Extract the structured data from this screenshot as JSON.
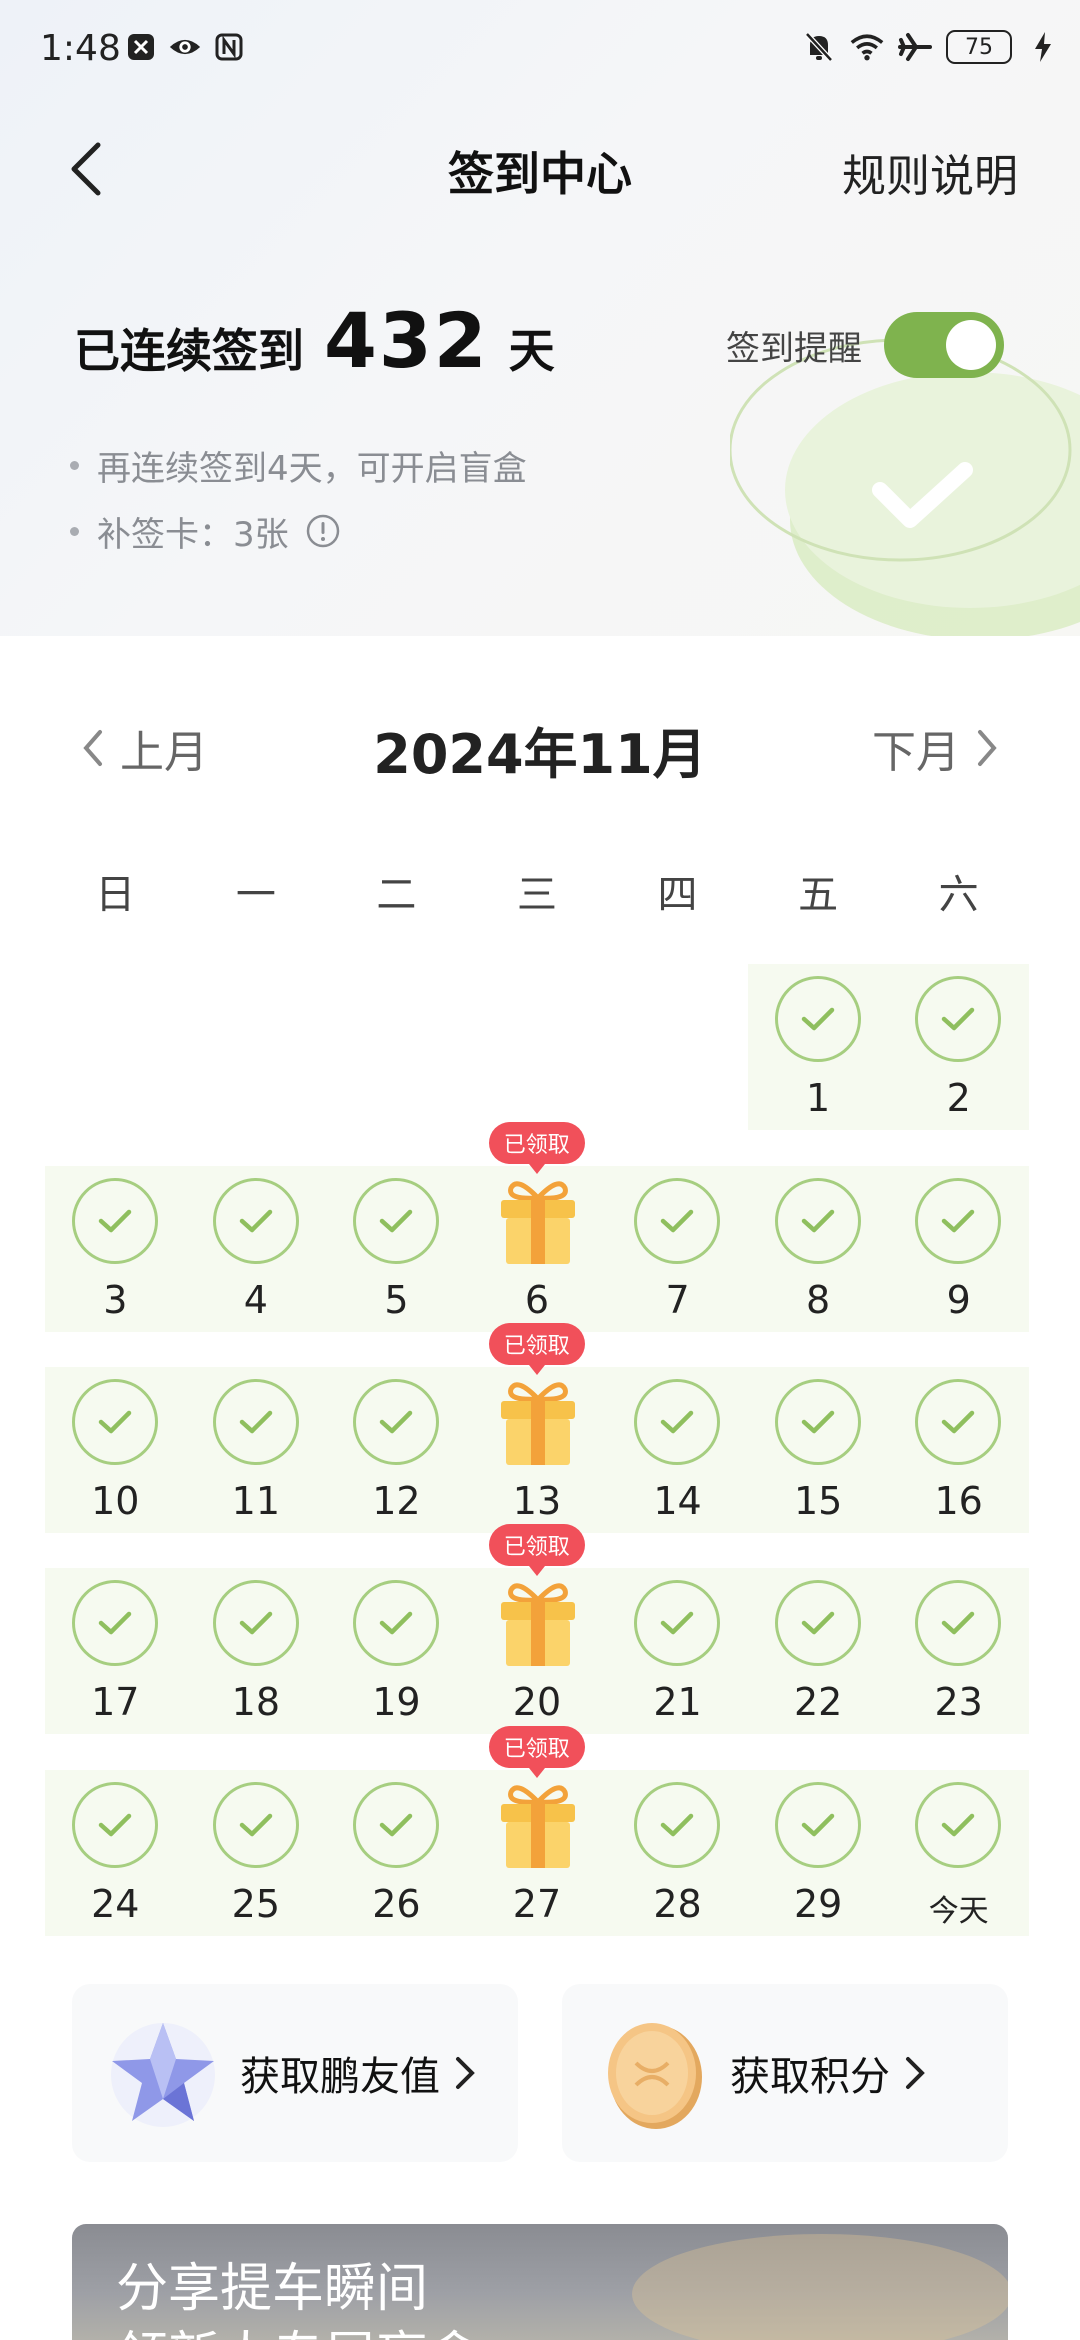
{
  "status_bar": {
    "time": "1:48",
    "battery": "75"
  },
  "nav": {
    "title": "签到中心",
    "rules": "规则说明"
  },
  "streak": {
    "prefix": "已连续签到",
    "days": "432",
    "suffix": "天"
  },
  "reminder": {
    "label": "签到提醒",
    "enabled": true
  },
  "tips": [
    {
      "text": "再连续签到4天，可开启盲盒"
    },
    {
      "text": "补签卡：3张"
    }
  ],
  "calendar": {
    "title": "2024年11月",
    "prev": "上月",
    "next": "下月",
    "weekdays": [
      "日",
      "一",
      "二",
      "三",
      "四",
      "五",
      "六"
    ],
    "claimed_label": "已领取",
    "weeks": [
      [
        {
          "day": "1",
          "col": 5,
          "type": "check"
        },
        {
          "day": "2",
          "col": 6,
          "type": "check"
        }
      ],
      [
        {
          "day": "3",
          "col": 0,
          "type": "check"
        },
        {
          "day": "4",
          "col": 1,
          "type": "check"
        },
        {
          "day": "5",
          "col": 2,
          "type": "check"
        },
        {
          "day": "6",
          "col": 3,
          "type": "gift"
        },
        {
          "day": "7",
          "col": 4,
          "type": "check"
        },
        {
          "day": "8",
          "col": 5,
          "type": "check"
        },
        {
          "day": "9",
          "col": 6,
          "type": "check"
        }
      ],
      [
        {
          "day": "10",
          "col": 0,
          "type": "check"
        },
        {
          "day": "11",
          "col": 1,
          "type": "check"
        },
        {
          "day": "12",
          "col": 2,
          "type": "check"
        },
        {
          "day": "13",
          "col": 3,
          "type": "gift"
        },
        {
          "day": "14",
          "col": 4,
          "type": "check"
        },
        {
          "day": "15",
          "col": 5,
          "type": "check"
        },
        {
          "day": "16",
          "col": 6,
          "type": "check"
        }
      ],
      [
        {
          "day": "17",
          "col": 0,
          "type": "check"
        },
        {
          "day": "18",
          "col": 1,
          "type": "check"
        },
        {
          "day": "19",
          "col": 2,
          "type": "check"
        },
        {
          "day": "20",
          "col": 3,
          "type": "gift"
        },
        {
          "day": "21",
          "col": 4,
          "type": "check"
        },
        {
          "day": "22",
          "col": 5,
          "type": "check"
        },
        {
          "day": "23",
          "col": 6,
          "type": "check"
        }
      ],
      [
        {
          "day": "24",
          "col": 0,
          "type": "check"
        },
        {
          "day": "25",
          "col": 1,
          "type": "check"
        },
        {
          "day": "26",
          "col": 2,
          "type": "check"
        },
        {
          "day": "27",
          "col": 3,
          "type": "gift"
        },
        {
          "day": "28",
          "col": 4,
          "type": "check"
        },
        {
          "day": "29",
          "col": 5,
          "type": "check"
        },
        {
          "day": "今天",
          "col": 6,
          "type": "check",
          "today": true
        }
      ]
    ]
  },
  "cards": {
    "friend_value": "获取鹏友值",
    "points": "获取积分"
  },
  "banner": {
    "title": "分享提车瞬间",
    "subtitle": "领新人专属盲盒"
  },
  "colors": {
    "accent_green": "#7fb34e",
    "check_green": "#a6ce80",
    "badge_red": "#f1505a",
    "gift_gold": "#f7c24a"
  }
}
